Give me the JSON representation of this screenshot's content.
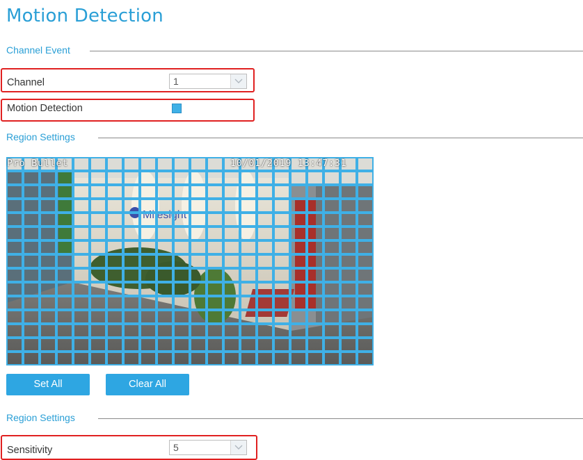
{
  "page": {
    "title": "Motion Detection"
  },
  "sections": {
    "channel_event": "Channel Event",
    "region_settings_1": "Region Settings",
    "region_settings_2": "Region Settings"
  },
  "channel": {
    "label": "Channel",
    "value": "1"
  },
  "motion_detection": {
    "label": "Motion Detection",
    "checked": true
  },
  "video": {
    "camera_name": "Pro Bullet",
    "timestamp": "10/01/2019 13:47:31",
    "grid": {
      "columns": 22,
      "rows": 15,
      "all_selected": true
    },
    "logo_text": "Milesight"
  },
  "buttons": {
    "set_all": "Set All",
    "clear_all": "Clear All"
  },
  "sensitivity": {
    "label": "Sensitivity",
    "value": "5"
  },
  "colors": {
    "accent": "#2a9fd6",
    "highlight": "#e02020",
    "grid": "#3fb0e6"
  }
}
